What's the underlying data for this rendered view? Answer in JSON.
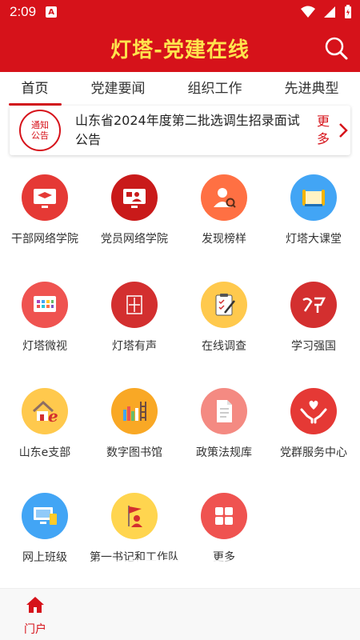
{
  "status_bar": {
    "time": "2:09",
    "app_badge": "A"
  },
  "app_bar": {
    "title": "灯塔-党建在线"
  },
  "tabs": [
    {
      "label": "首页",
      "active": true
    },
    {
      "label": "党建要闻",
      "active": false
    },
    {
      "label": "组织工作",
      "active": false
    },
    {
      "label": "先进典型",
      "active": false
    }
  ],
  "notice": {
    "badge_line1": "通知",
    "badge_line2": "公告",
    "text": "山东省2024年度第二批选调生招录面试公告",
    "more": "更多"
  },
  "grid": [
    {
      "label": "干部网络学院",
      "icon": "mortarboard-screen-icon",
      "color": "#e53935"
    },
    {
      "label": "党员网络学院",
      "icon": "party-monitor-icon",
      "color": "#d81b1b"
    },
    {
      "label": "发现榜样",
      "icon": "person-search-icon",
      "color": "#ff7043"
    },
    {
      "label": "灯塔大课堂",
      "icon": "scroll-icon",
      "color": "#42a5f5"
    },
    {
      "label": "灯塔微视",
      "icon": "tv-grid-icon",
      "color": "#ef5350"
    },
    {
      "label": "灯塔有声",
      "icon": "dengta-youshang-seal-icon",
      "color": "#d32f2f"
    },
    {
      "label": "在线调查",
      "icon": "clipboard-pen-icon",
      "color": "#ffc94d"
    },
    {
      "label": "学习强国",
      "icon": "xuexi-calligraphy-icon",
      "color": "#d32f2f"
    },
    {
      "label": "山东e支部",
      "icon": "house-e-icon",
      "color": "#ffc94d"
    },
    {
      "label": "数字图书馆",
      "icon": "books-ladder-icon",
      "color": "#f9a825"
    },
    {
      "label": "政策法规库",
      "icon": "document-icon",
      "color": "#f48a82"
    },
    {
      "label": "党群服务中心",
      "icon": "hands-heart-icon",
      "color": "#e53935"
    },
    {
      "label": "网上班级",
      "icon": "monitor-desk-icon",
      "color": "#42a5f5"
    },
    {
      "label": "第一书记和工作队",
      "icon": "flag-person-icon",
      "color": "#ffd54f"
    },
    {
      "label": "更多",
      "icon": "four-squares-icon",
      "color": "#ef5350"
    }
  ],
  "bottom_nav": {
    "home_label": "门户"
  }
}
